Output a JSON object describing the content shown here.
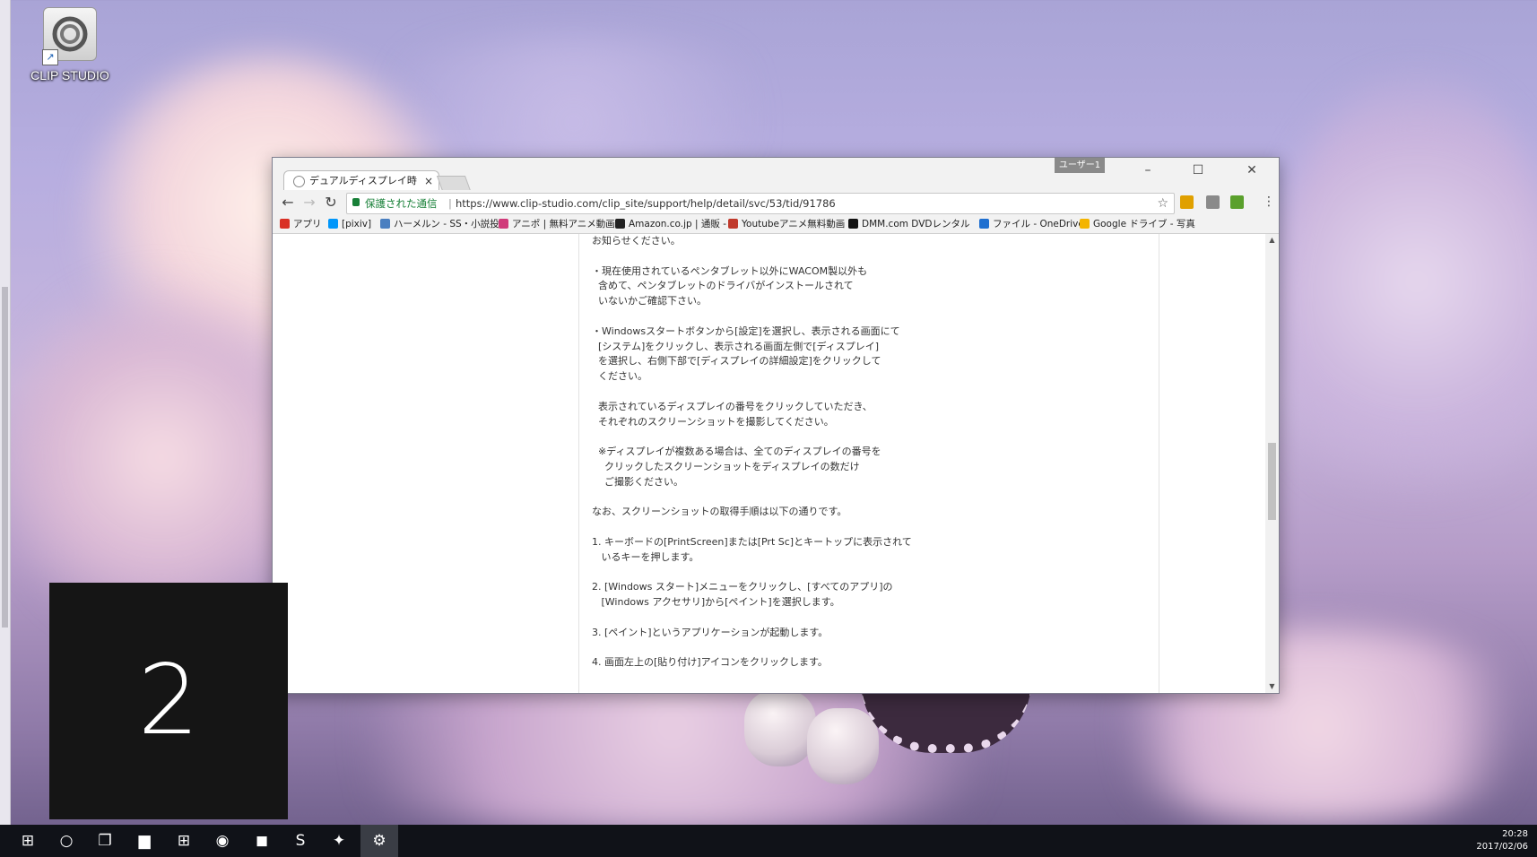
{
  "desktop": {
    "icons": [
      {
        "label": "CLIP STUDIO",
        "icon": "clip-studio-icon"
      }
    ],
    "virtual_desktop_number": "2"
  },
  "browser": {
    "tab_title": "デュアルディスプレイ時、キャン",
    "tab_close": "×",
    "user_badge": "ユーザー1",
    "window_controls": {
      "minimize": "–",
      "maximize": "☐",
      "close": "✕"
    },
    "nav": {
      "back": "←",
      "forward": "→",
      "reload": "↻"
    },
    "security_label": "保護された通信",
    "url": "https://www.clip-studio.com/clip_site/support/help/detail/svc/53/tid/91786",
    "bookmark_star": "☆",
    "menu_icon": "⋮",
    "extensions": [
      {
        "name": "counter-extension-icon",
        "color": "#e0a000"
      },
      {
        "name": "s-extension-icon",
        "color": "#8a8a8a"
      },
      {
        "name": "green-extension-icon",
        "color": "#5aa02c"
      }
    ],
    "bookmarks": [
      {
        "label": "アプリ",
        "color": "#d93025"
      },
      {
        "label": "[pixiv]",
        "color": "#0096fa"
      },
      {
        "label": "ハーメルン - SS・小説投",
        "color": "#4a7fc0"
      },
      {
        "label": "アニポ | 無料アニメ動画",
        "color": "#d03a7a"
      },
      {
        "label": "Amazon.co.jp | 通販 -",
        "color": "#222222"
      },
      {
        "label": "Youtubeアニメ無料動画",
        "color": "#c0392b"
      },
      {
        "label": "DMM.com DVDレンタル",
        "color": "#111111"
      },
      {
        "label": "ファイル - OneDrive",
        "color": "#1e6fd0"
      },
      {
        "label": "Google ドライブ - 写真",
        "color": "#f4b400"
      }
    ]
  },
  "article": {
    "lines": [
      "お知らせください。",
      "",
      "・現在使用されているペンタブレット以外にWACOM製以外も",
      "  含めて、ペンタブレットのドライバがインストールされて",
      "  いないかご確認下さい。",
      "",
      "・Windowsスタートボタンから[設定]を選択し、表示される画面にて",
      "  [システム]をクリックし、表示される画面左側で[ディスプレイ]",
      "  を選択し、右側下部で[ディスプレイの詳細設定]をクリックして",
      "  ください。",
      "",
      "  表示されているディスプレイの番号をクリックしていただき、",
      "  それぞれのスクリーンショットを撮影してください。",
      "",
      "  ※ディスプレイが複数ある場合は、全てのディスプレイの番号を",
      "    クリックしたスクリーンショットをディスプレイの数だけ",
      "    ご撮影ください。",
      "",
      "なお、スクリーンショットの取得手順は以下の通りです。",
      "",
      "1. キーボードの[PrintScreen]または[Prt Sc]とキートップに表示されて",
      "   いるキーを押します。",
      "",
      "2. [Windows スタート]メニューをクリックし、[すべてのアプリ]の",
      "   [Windows アクセサリ]から[ペイント]を選択します。",
      "",
      "3. [ペイント]というアプリケーションが起動します。",
      "",
      "4. 画面左上の[貼り付け]アイコンをクリックします。"
    ]
  },
  "taskbar": {
    "items": [
      {
        "name": "start-button",
        "glyph": "⊞"
      },
      {
        "name": "cortana-search-button",
        "glyph": "○"
      },
      {
        "name": "task-view-button",
        "glyph": "❐"
      },
      {
        "name": "file-explorer-icon",
        "glyph": "▆"
      },
      {
        "name": "store-icon",
        "glyph": "⊞"
      },
      {
        "name": "chrome-icon",
        "glyph": "◉"
      },
      {
        "name": "line-icon",
        "glyph": "◼"
      },
      {
        "name": "skype-icon",
        "glyph": "S"
      },
      {
        "name": "twitter-icon",
        "glyph": "✦"
      },
      {
        "name": "settings-icon",
        "glyph": "⚙"
      }
    ],
    "clock": {
      "time": "20:28",
      "date": "2017/02/06"
    }
  }
}
